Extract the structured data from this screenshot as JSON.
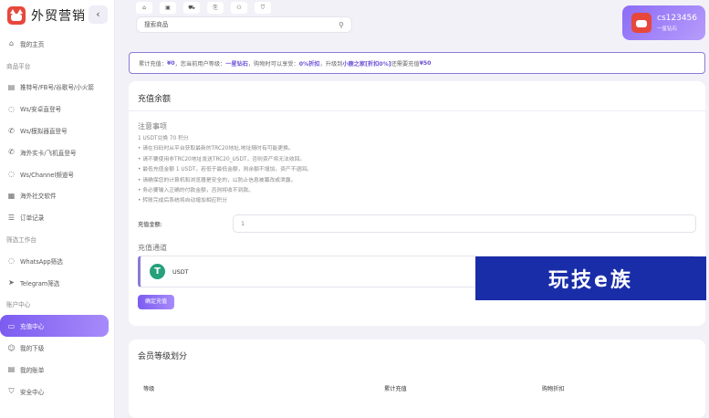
{
  "brand": {
    "name": "外贸营销",
    "collapse_icon": "chevron-left-icon"
  },
  "sidebar": {
    "items": [
      {
        "type": "item",
        "label": "我的主页",
        "icon": "home-icon"
      },
      {
        "type": "section",
        "label": "商品平台"
      },
      {
        "type": "item",
        "label": "推特号/FB号/谷歌号/小火箭",
        "icon": "doc-icon"
      },
      {
        "type": "item",
        "label": "Ws/安卓直登号",
        "icon": "whatsapp-icon"
      },
      {
        "type": "item",
        "label": "Ws/模拟器直登号",
        "icon": "phone-icon"
      },
      {
        "type": "item",
        "label": "海外实卡/飞机直登号",
        "icon": "phone-icon"
      },
      {
        "type": "item",
        "label": "Ws/Channel频道号",
        "icon": "whatsapp-icon"
      },
      {
        "type": "item",
        "label": "海外社交软件",
        "icon": "grid-icon"
      },
      {
        "type": "item",
        "label": "订单记录",
        "icon": "list-icon"
      },
      {
        "type": "section",
        "label": "筛选工作台"
      },
      {
        "type": "item",
        "label": "WhatsApp筛选",
        "icon": "whatsapp-icon"
      },
      {
        "type": "item",
        "label": "Telegram筛选",
        "icon": "telegram-icon"
      },
      {
        "type": "section",
        "label": "账户中心"
      },
      {
        "type": "item",
        "label": "充值中心",
        "icon": "wallet-icon",
        "active": true
      },
      {
        "type": "item",
        "label": "我的下级",
        "icon": "user-icon"
      },
      {
        "type": "item",
        "label": "我的账单",
        "icon": "bill-icon"
      },
      {
        "type": "item",
        "label": "安全中心",
        "icon": "shield-icon"
      }
    ]
  },
  "header": {
    "tabs": [
      "⌂",
      "▣",
      "⛟",
      "⎘",
      "⚇",
      "⛉"
    ],
    "search_placeholder": "搜索商品",
    "user": {
      "name": "cs123456",
      "level": "一星钻石"
    }
  },
  "notice": {
    "p1": "累计充值：",
    "total": "¥0",
    "p2": "，您当前用户等级：",
    "level": "一星钻石",
    "p3": "，购物时可以享受：",
    "discount": "0%折扣",
    "p4": "，升级到",
    "next_level": "小鹿之家[折扣0%]",
    "p5": "还需要充值",
    "need": "¥50"
  },
  "recharge": {
    "title": "充值余额",
    "notes_title": "注意事项",
    "notes": [
      "1 USDT兑换 70 积分",
      "• 请在扫码时从平台获取最新的TRC20地址,地址随时有可能更换。",
      "• 请不要使用非TRC20地址发送TRC20_USDT，否则资产将无法收回。",
      "• 最低充值金额 1 USDT，若低于最低金额，则余额不增加，资产不退回。",
      "• 请确保您的计算机和浏览器是安全的，以防止信息被篡改或泄露。",
      "• 务必要输入正确的付款金额，否则将收不到款。",
      "• 转账完成后系统将自动增加相应积分"
    ],
    "amount_label": "充值金额:",
    "amount_value": "1",
    "channel_title": "充值通道",
    "channel_label": "USDT",
    "confirm": "确定充值"
  },
  "watermark": "玩技e族",
  "levels": {
    "title": "会员等级划分",
    "headers": [
      "等级",
      "累计充值",
      "购物折扣"
    ]
  }
}
